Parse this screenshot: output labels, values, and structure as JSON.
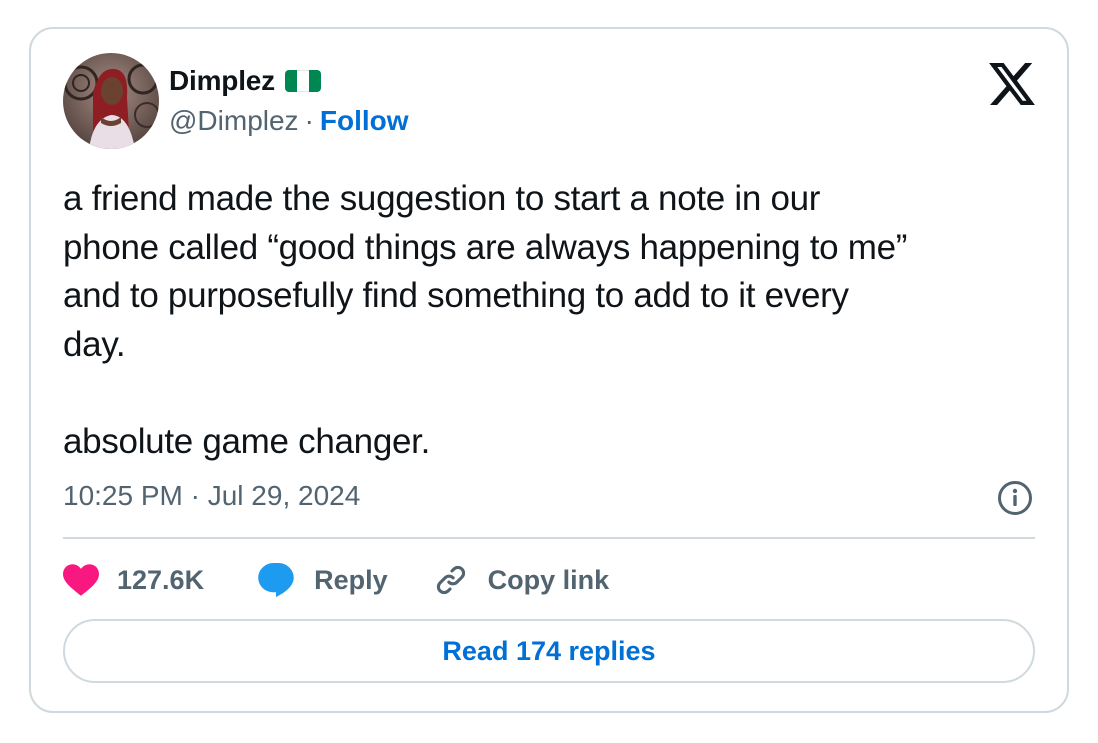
{
  "author": {
    "name": "Dimplez",
    "handle": "@Dimplez",
    "separator": "·",
    "follow_label": "Follow",
    "flag_icon": "nigeria-flag-icon",
    "flag_colors": [
      "#008751",
      "#ffffff",
      "#008751"
    ]
  },
  "platform_icon": "x-logo-icon",
  "tweet": {
    "text": "a friend made the suggestion to start a note in our\nphone called “good things are always happening to me”\nand to purposefully find something to add to it every\nday.\n\nabsolute game changer.",
    "timestamp": "10:25 PM · Jul 29, 2024"
  },
  "actions": {
    "like_count": "127.6K",
    "reply_label": "Reply",
    "copy_link_label": "Copy link"
  },
  "read_replies_label": "Read 174 replies",
  "colors": {
    "link": "#006fd6",
    "secondary_text": "#536471",
    "like": "#f91880",
    "reply": "#1d9bf0",
    "border": "#cfd9de"
  }
}
